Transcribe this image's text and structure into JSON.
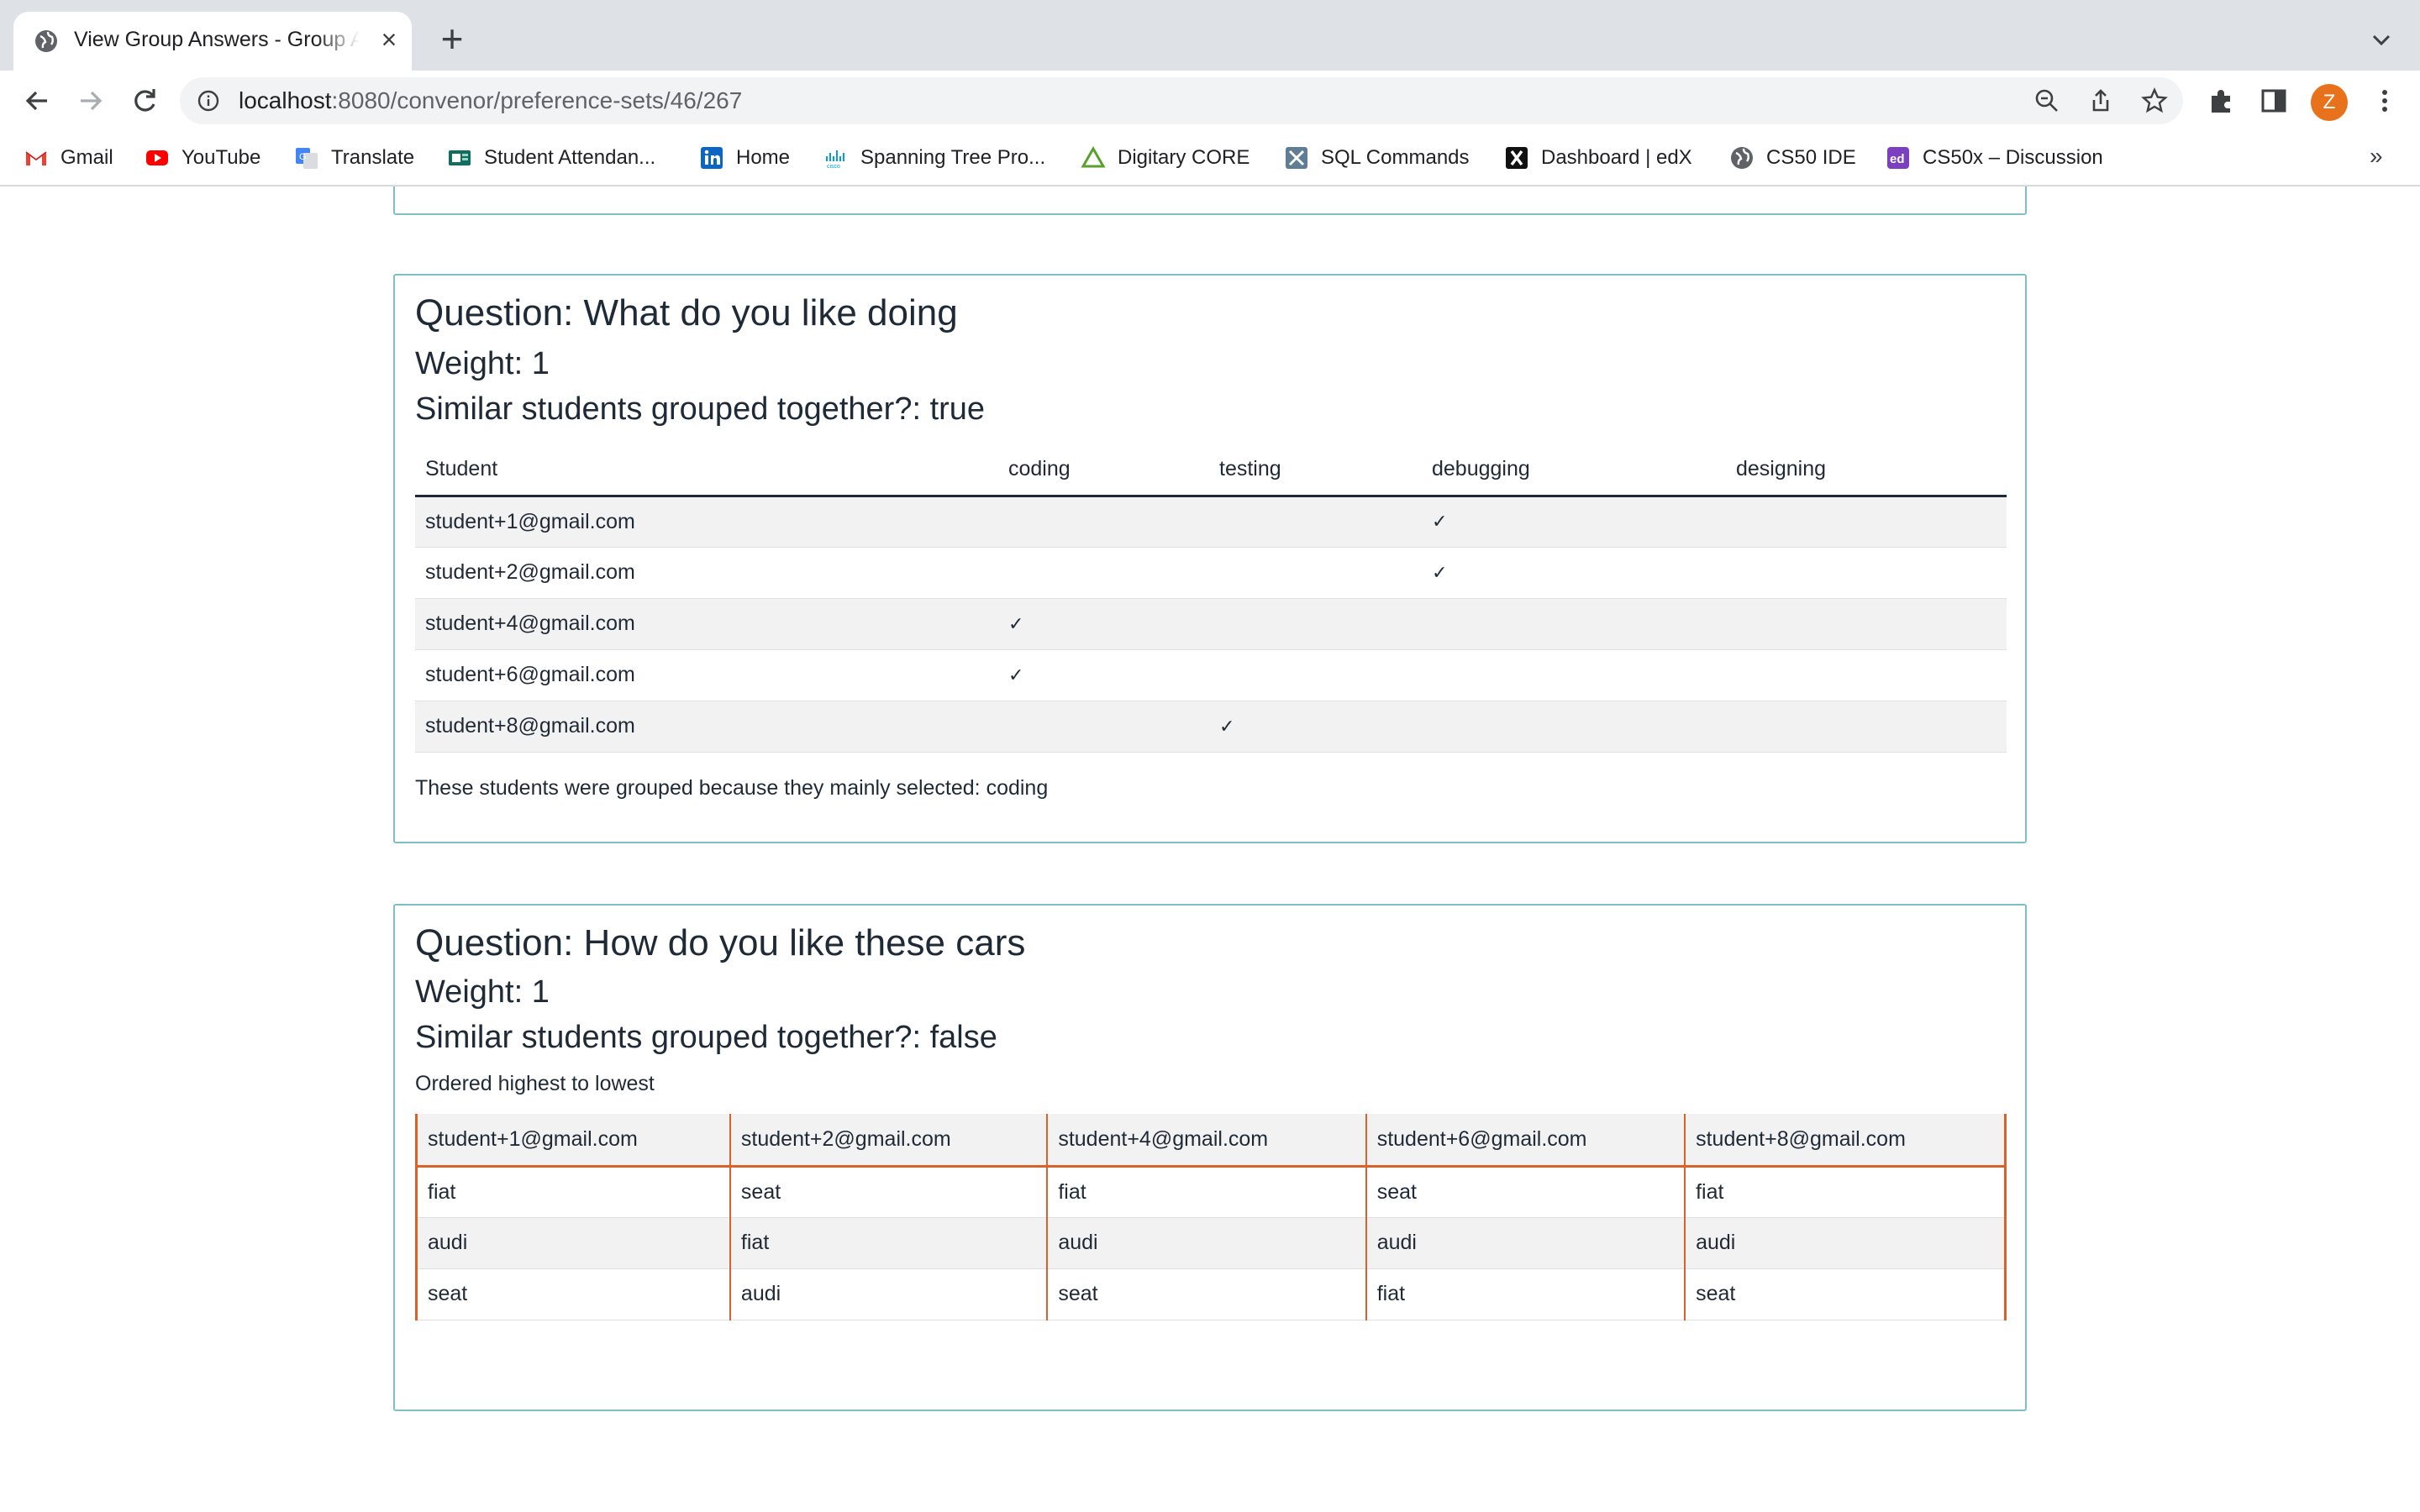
{
  "browser": {
    "tab_title": "View Group Answers - Group Allocation",
    "url_host": "localhost",
    "url_path": ":8080/convenor/preference-sets/46/267",
    "profile_initial": "Z",
    "bookmarks": [
      {
        "label": "Gmail",
        "icon": "gmail-icon"
      },
      {
        "label": "YouTube",
        "icon": "youtube-icon"
      },
      {
        "label": "Translate",
        "icon": "translate-icon"
      },
      {
        "label": "Student Attendan...",
        "icon": "attendance-icon"
      },
      {
        "label": "Home",
        "icon": "linkedin-icon"
      },
      {
        "label": "Spanning Tree Pro...",
        "icon": "cisco-icon"
      },
      {
        "label": "Digitary CORE",
        "icon": "digitary-icon"
      },
      {
        "label": "SQL Commands",
        "icon": "sql-icon"
      },
      {
        "label": "Dashboard | edX",
        "icon": "edx-icon"
      },
      {
        "label": "CS50 IDE",
        "icon": "globe-icon"
      },
      {
        "label": "CS50x – Discussion",
        "icon": "ed-icon"
      }
    ]
  },
  "questions": [
    {
      "title": "Question: What do you like doing",
      "weight": "Weight: 1",
      "grouped": "Similar students grouped together?: true",
      "columns": [
        "Student",
        "coding",
        "testing",
        "debugging",
        "designing"
      ],
      "rows": [
        {
          "student": "student+1@gmail.com",
          "marks": [
            "",
            "",
            "✓",
            ""
          ]
        },
        {
          "student": "student+2@gmail.com",
          "marks": [
            "",
            "",
            "✓",
            ""
          ]
        },
        {
          "student": "student+4@gmail.com",
          "marks": [
            "✓",
            "",
            "",
            ""
          ]
        },
        {
          "student": "student+6@gmail.com",
          "marks": [
            "✓",
            "",
            "",
            ""
          ]
        },
        {
          "student": "student+8@gmail.com",
          "marks": [
            "",
            "✓",
            "",
            ""
          ]
        }
      ],
      "summary": "These students were grouped because they mainly selected: coding"
    },
    {
      "title": "Question: How do you like these cars",
      "weight": "Weight: 1",
      "grouped": "Similar students grouped together?: false",
      "order_note": "Ordered highest to lowest",
      "columns": [
        "student+1@gmail.com",
        "student+2@gmail.com",
        "student+4@gmail.com",
        "student+6@gmail.com",
        "student+8@gmail.com"
      ],
      "rows": [
        [
          "fiat",
          "seat",
          "fiat",
          "seat",
          "fiat"
        ],
        [
          "audi",
          "fiat",
          "audi",
          "audi",
          "audi"
        ],
        [
          "seat",
          "audi",
          "seat",
          "fiat",
          "seat"
        ]
      ]
    }
  ]
}
